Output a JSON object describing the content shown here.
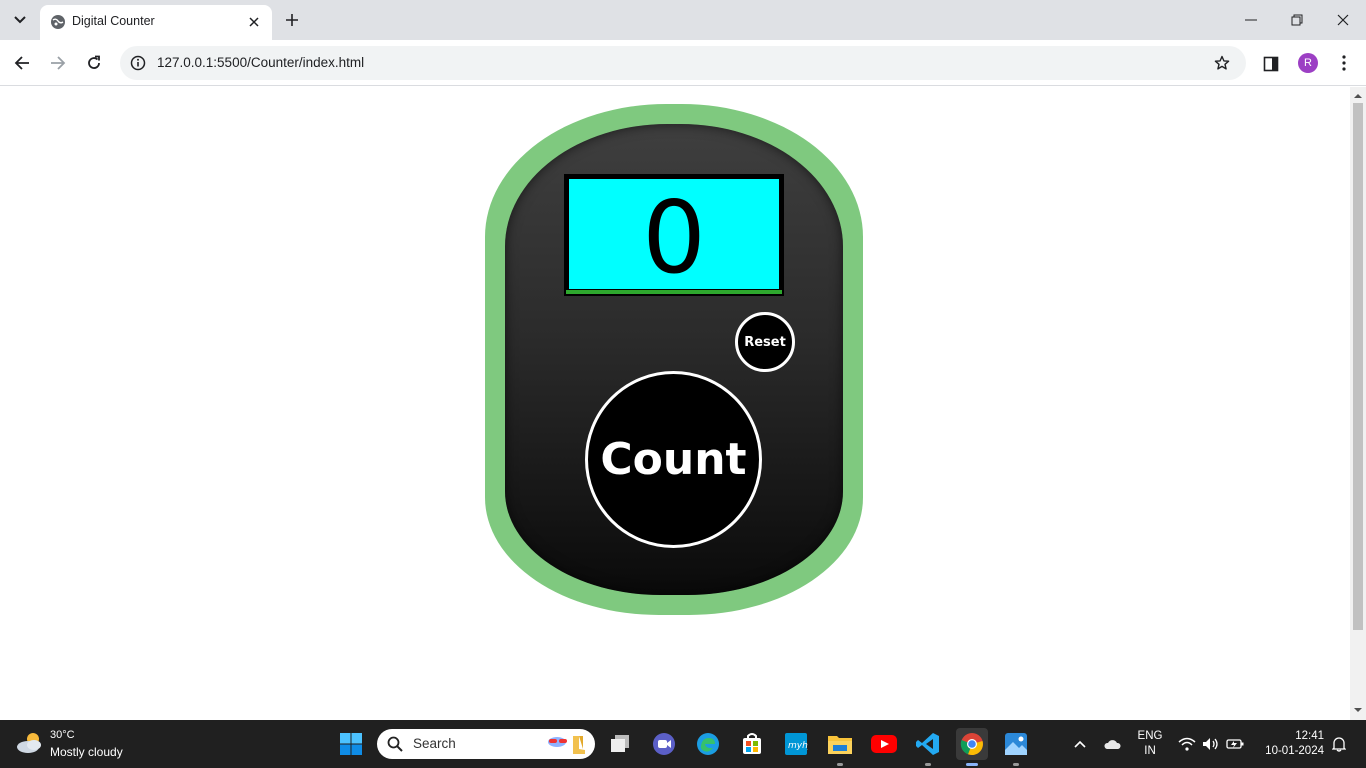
{
  "browser": {
    "tab_title": "Digital Counter",
    "url": "127.0.0.1:5500/Counter/index.html",
    "profile_initial": "R"
  },
  "counter": {
    "display_value": "0",
    "reset_label": "Reset",
    "count_label": "Count",
    "colors": {
      "outer_ring": "#7fc97f",
      "body": "#2b2b2b",
      "screen": "#00ffff",
      "screen_bar": "#2ea82e",
      "button": "#000000"
    }
  },
  "taskbar": {
    "weather_temp": "30°C",
    "weather_desc": "Mostly cloudy",
    "search_placeholder": "Search",
    "language": "ENG",
    "region": "IN",
    "time": "12:41",
    "date": "10-01-2024",
    "pinned_apps": [
      "start-icon",
      "task-view-icon",
      "meet-icon",
      "edge-icon",
      "store-icon",
      "hp-icon",
      "file-explorer-icon",
      "youtube-icon",
      "vscode-icon",
      "chrome-icon",
      "photos-icon"
    ]
  }
}
